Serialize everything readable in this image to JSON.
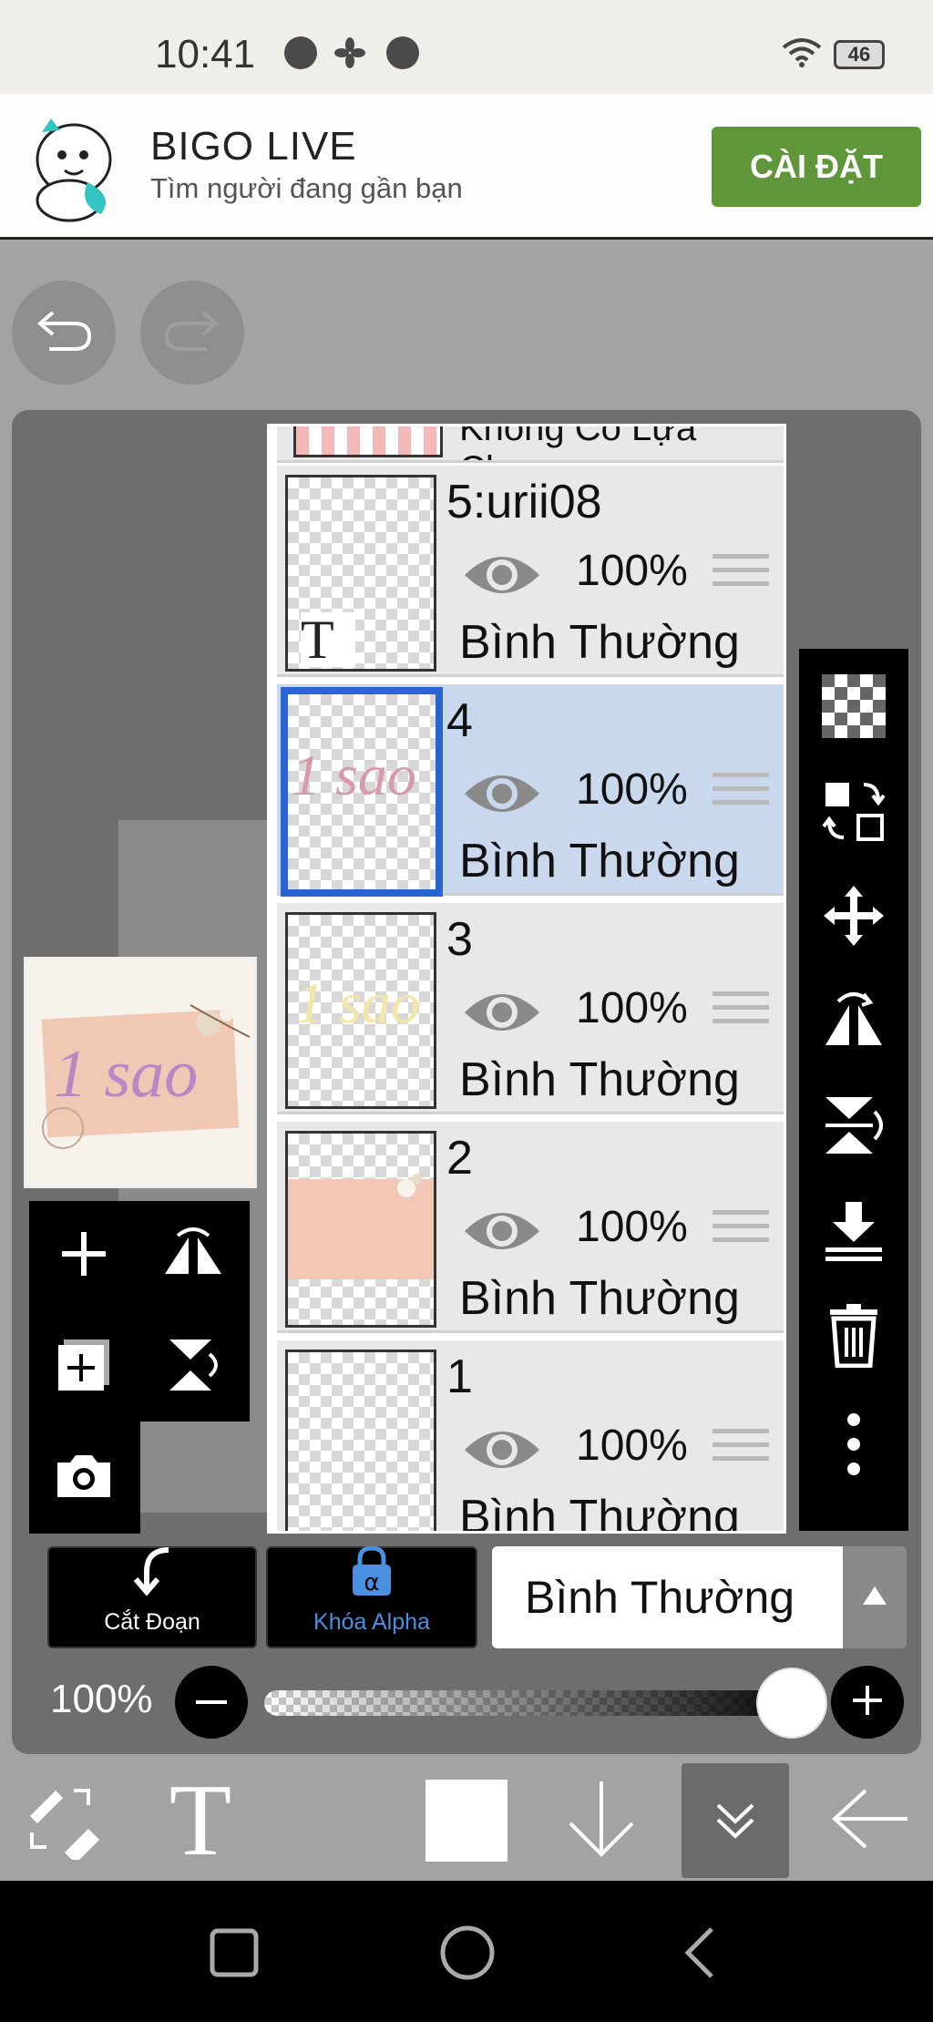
{
  "status_bar": {
    "time": "10:41",
    "battery": "46"
  },
  "ad": {
    "title": "BIGO LIVE",
    "subtitle": "Tìm người đang gần bạn",
    "install_label": "CÀI ĐẶT",
    "install_color": "#5f9639"
  },
  "layers_panel": {
    "partial_top_label": "Không Có Lựa Chọn",
    "layers": [
      {
        "name": "5:urii08",
        "opacity": "100%",
        "blend": "Bình Thường",
        "selected": false,
        "is_text": true
      },
      {
        "name": "4",
        "opacity": "100%",
        "blend": "Bình Thường",
        "selected": true,
        "is_text": false
      },
      {
        "name": "3",
        "opacity": "100%",
        "blend": "Bình Thường",
        "selected": false,
        "is_text": false
      },
      {
        "name": "2",
        "opacity": "100%",
        "blend": "Bình Thường",
        "selected": false,
        "is_text": false
      },
      {
        "name": "1",
        "opacity": "100%",
        "blend": "Bình Thường",
        "selected": false,
        "is_text": false
      }
    ],
    "selected_color": "#2864d2"
  },
  "thumbnail_text": "1 sao",
  "layer_thumb_text": "1 sao",
  "text_layer_mark": "T",
  "bottom_controls": {
    "clip_label": "Cắt Đoạn",
    "alpha_lock_label": "Khóa Alpha",
    "alpha_lock_color": "#4a90e2",
    "blend_mode": "Bình Thường"
  },
  "opacity": {
    "label": "100%",
    "value": 1.0
  },
  "toolbar": {
    "text_tool": "T"
  },
  "icons": {
    "right_toolbar": [
      "checker-icon",
      "transfer-icon",
      "move-icon",
      "flip-horizontal-icon",
      "flip-vertical-icon",
      "merge-down-icon",
      "trash-icon",
      "more-icon"
    ],
    "left_toolbar": [
      "add-layer-icon",
      "rotate-flip-h-icon",
      "add-copy-icon",
      "rotate-flip-v-icon",
      "camera-icon"
    ]
  }
}
